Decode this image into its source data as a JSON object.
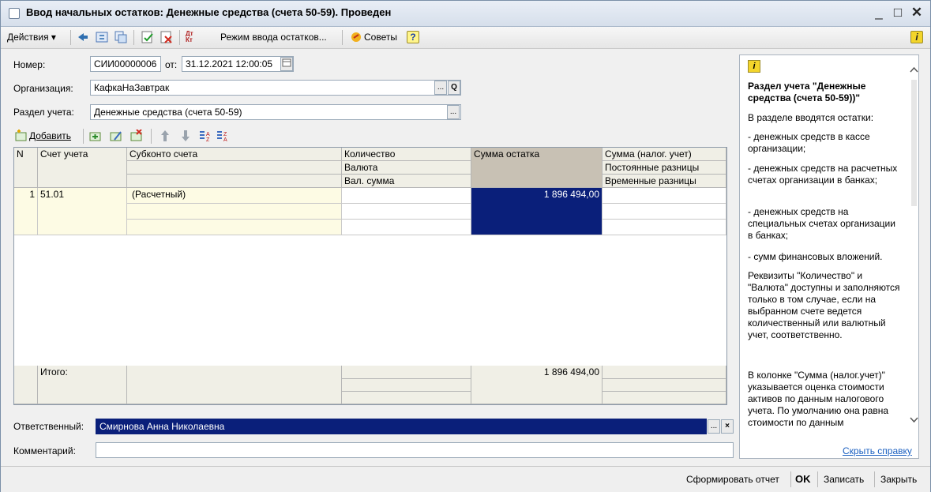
{
  "window": {
    "title": "Ввод начальных остатков: Денежные средства (счета 50-59). Проведен",
    "minimize": "_",
    "maximize": "□",
    "close": "✕"
  },
  "toolbar": {
    "actions": "Действия ▾",
    "mode_button": "Режим ввода остатков...",
    "tips_button": "Советы",
    "help_q": "?",
    "info": "i",
    "dt_kt": "Дт Кт"
  },
  "form": {
    "number_label": "Номер:",
    "number_value": "СИИ00000006",
    "date_label": "от:",
    "date_value": "31.12.2021 12:00:05",
    "org_label": "Организация:",
    "org_value": "КафкаНаЗавтрак",
    "section_label": "Раздел учета:",
    "section_value": "Денежные средства (счета 50-59)",
    "ellipsis": "...",
    "search": "Q"
  },
  "grid_toolbar": {
    "add_label": "Добавить"
  },
  "grid": {
    "headers": {
      "n": "N",
      "account": "Счет учета",
      "subconto": "Субконто счета",
      "qty": "Количество",
      "currency": "Валюта",
      "cur_sum": "Вал. сумма",
      "balance": "Сумма остатка",
      "tax_sum": "Сумма (налог. учет)",
      "perm_diff": "Постоянные разницы",
      "temp_diff": "Временные разницы"
    },
    "rows": [
      {
        "n": "1",
        "account": "51.01",
        "subconto": "(Расчетный)",
        "balance": "1 896 494,00"
      }
    ],
    "footer": {
      "total_label": "Итого:",
      "total_balance": "1 896 494,00"
    }
  },
  "responsible": {
    "label": "Ответственный:",
    "value": "Смирнова Анна Николаевна",
    "clear": "×"
  },
  "comment": {
    "label": "Комментарий:",
    "value": ""
  },
  "help": {
    "icon": "i",
    "heading": "Раздел учета \"Денежные средства (счета 50-59))\"",
    "paragraphs": [
      "В разделе вводятся остатки:",
      "- денежных средств в кассе организации;",
      "- денежных средств на расчетных счетах организации в банках;",
      "- денежных средств на специальных счетах организации в банках;",
      "- сумм финансовых вложений.",
      "Реквизиты \"Количество\" и \"Валюта\" доступны и заполняются только в том случае, если на выбранном счете ведется количественный или валютный учет, соответственно.",
      "В колонке \"Сумма (налог.учет)\" указывается оценка стоимости активов по данным налогового учета. По умолчанию она равна стоимости по данным"
    ],
    "hide_link": "Скрыть справку"
  },
  "buttons": {
    "report": "Сформировать отчет",
    "ok": "OK",
    "save": "Записать",
    "close": "Закрыть"
  }
}
